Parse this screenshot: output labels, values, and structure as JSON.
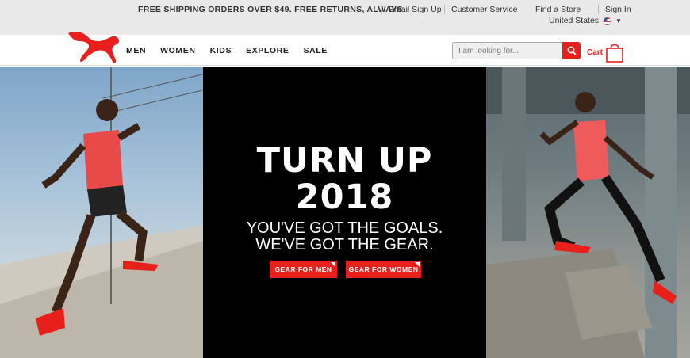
{
  "topbar": {
    "promo": "FREE SHIPPING ORDERS OVER $49. FREE RETURNS, ALWAYS",
    "email_signup": "Email Sign Up",
    "customer_service": "Customer Service",
    "find_store": "Find a Store",
    "sign_in": "Sign In",
    "country": "United States"
  },
  "nav": {
    "items": [
      {
        "label": "MEN"
      },
      {
        "label": "WOMEN"
      },
      {
        "label": "KIDS"
      },
      {
        "label": "EXPLORE"
      },
      {
        "label": "SALE"
      }
    ],
    "search_placeholder": "I am looking for...",
    "cart_label": "Cart"
  },
  "hero": {
    "headline_1": "TURN UP",
    "headline_2": "2018",
    "sub_1": "YOU'VE GOT THE GOALS.",
    "sub_2": "WE'VE GOT THE GEAR.",
    "cta_men": "GEAR FOR MEN",
    "cta_women": "GEAR FOR WOMEN"
  },
  "colors": {
    "brand_red": "#e8201c",
    "topbar_bg": "#e9e9e9",
    "hero_mid_bg": "#000000"
  }
}
